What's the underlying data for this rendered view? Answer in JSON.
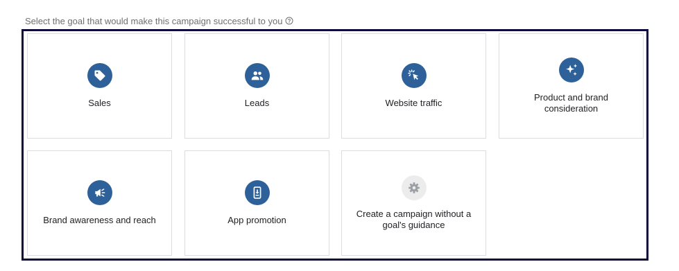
{
  "prompt": {
    "text": "Select the goal that would make this campaign successful to you",
    "icon": "help-circle-icon"
  },
  "goals": [
    {
      "label": "Sales",
      "icon": "sales-tag-icon"
    },
    {
      "label": "Leads",
      "icon": "leads-people-icon"
    },
    {
      "label": "Website traffic",
      "icon": "cursor-click-icon"
    },
    {
      "label": "Product and brand consideration",
      "icon": "sparkle-icon"
    },
    {
      "label": "Brand awareness and reach",
      "icon": "megaphone-icon"
    },
    {
      "label": "App promotion",
      "icon": "phone-download-icon"
    },
    {
      "label": "Create a campaign without a goal's guidance",
      "icon": "gear-icon"
    }
  ],
  "colors": {
    "accent": "#2e6199",
    "muted_icon_bg": "#ececec",
    "frame_border": "#0d0a3b",
    "card_border": "#dadce0",
    "prompt_text": "#6f6f6f"
  }
}
